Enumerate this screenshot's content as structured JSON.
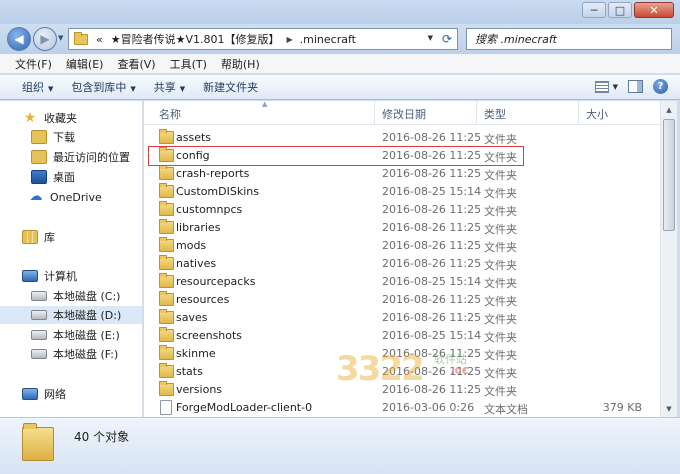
{
  "window": {
    "controls": [
      "─",
      "□",
      "✕"
    ]
  },
  "address": {
    "crumbs": [
      "«",
      "★冒险者传说★V1.801【修复版】",
      ".minecraft"
    ],
    "search_placeholder": "搜索 .minecraft"
  },
  "menu": {
    "items": [
      "文件(F)",
      "编辑(E)",
      "查看(V)",
      "工具(T)",
      "帮助(H)"
    ]
  },
  "toolbar": {
    "organize": "组织",
    "include_library": "包含到库中",
    "share": "共享",
    "new_folder": "新建文件夹"
  },
  "nav": {
    "favorites": "收藏夹",
    "downloads": "下载",
    "recent": "最近访问的位置",
    "desktop": "桌面",
    "onedrive": "OneDrive",
    "libraries": "库",
    "computer": "计算机",
    "drive_c": "本地磁盘 (C:)",
    "drive_d": "本地磁盘 (D:)",
    "drive_e": "本地磁盘 (E:)",
    "drive_f": "本地磁盘 (F:)",
    "network": "网络"
  },
  "columns": {
    "name": "名称",
    "date": "修改日期",
    "type": "类型",
    "size": "大小"
  },
  "files": [
    {
      "name": "assets",
      "date": "2016-08-26 11:25",
      "type": "文件夹",
      "size": "",
      "kind": "folder"
    },
    {
      "name": "config",
      "date": "2016-08-26 11:25",
      "type": "文件夹",
      "size": "",
      "kind": "folder"
    },
    {
      "name": "crash-reports",
      "date": "2016-08-26 11:25",
      "type": "文件夹",
      "size": "",
      "kind": "folder"
    },
    {
      "name": "CustomDISkins",
      "date": "2016-08-25 15:14",
      "type": "文件夹",
      "size": "",
      "kind": "folder"
    },
    {
      "name": "customnpcs",
      "date": "2016-08-26 11:25",
      "type": "文件夹",
      "size": "",
      "kind": "folder"
    },
    {
      "name": "libraries",
      "date": "2016-08-26 11:25",
      "type": "文件夹",
      "size": "",
      "kind": "folder"
    },
    {
      "name": "mods",
      "date": "2016-08-26 11:25",
      "type": "文件夹",
      "size": "",
      "kind": "folder"
    },
    {
      "name": "natives",
      "date": "2016-08-26 11:25",
      "type": "文件夹",
      "size": "",
      "kind": "folder"
    },
    {
      "name": "resourcepacks",
      "date": "2016-08-25 15:14",
      "type": "文件夹",
      "size": "",
      "kind": "folder"
    },
    {
      "name": "resources",
      "date": "2016-08-26 11:25",
      "type": "文件夹",
      "size": "",
      "kind": "folder"
    },
    {
      "name": "saves",
      "date": "2016-08-26 11:25",
      "type": "文件夹",
      "size": "",
      "kind": "folder"
    },
    {
      "name": "screenshots",
      "date": "2016-08-25 15:14",
      "type": "文件夹",
      "size": "",
      "kind": "folder"
    },
    {
      "name": "skinme",
      "date": "2016-08-26 11:25",
      "type": "文件夹",
      "size": "",
      "kind": "folder"
    },
    {
      "name": "stats",
      "date": "2016-08-26 11:25",
      "type": "文件夹",
      "size": "",
      "kind": "folder"
    },
    {
      "name": "versions",
      "date": "2016-08-26 11:25",
      "type": "文件夹",
      "size": "",
      "kind": "folder"
    },
    {
      "name": "ForgeModLoader-client-0",
      "date": "2016-03-06 0:26",
      "type": "文本文档",
      "size": "379 KB",
      "kind": "doc"
    }
  ],
  "watermark": {
    "main": "3322",
    "sub": "软件站",
    "cc": ".cc"
  },
  "status": {
    "count": "40 个对象"
  },
  "colors": {
    "highlight_border": "#e23b3b",
    "selected_nav": "#dbe8f7"
  }
}
